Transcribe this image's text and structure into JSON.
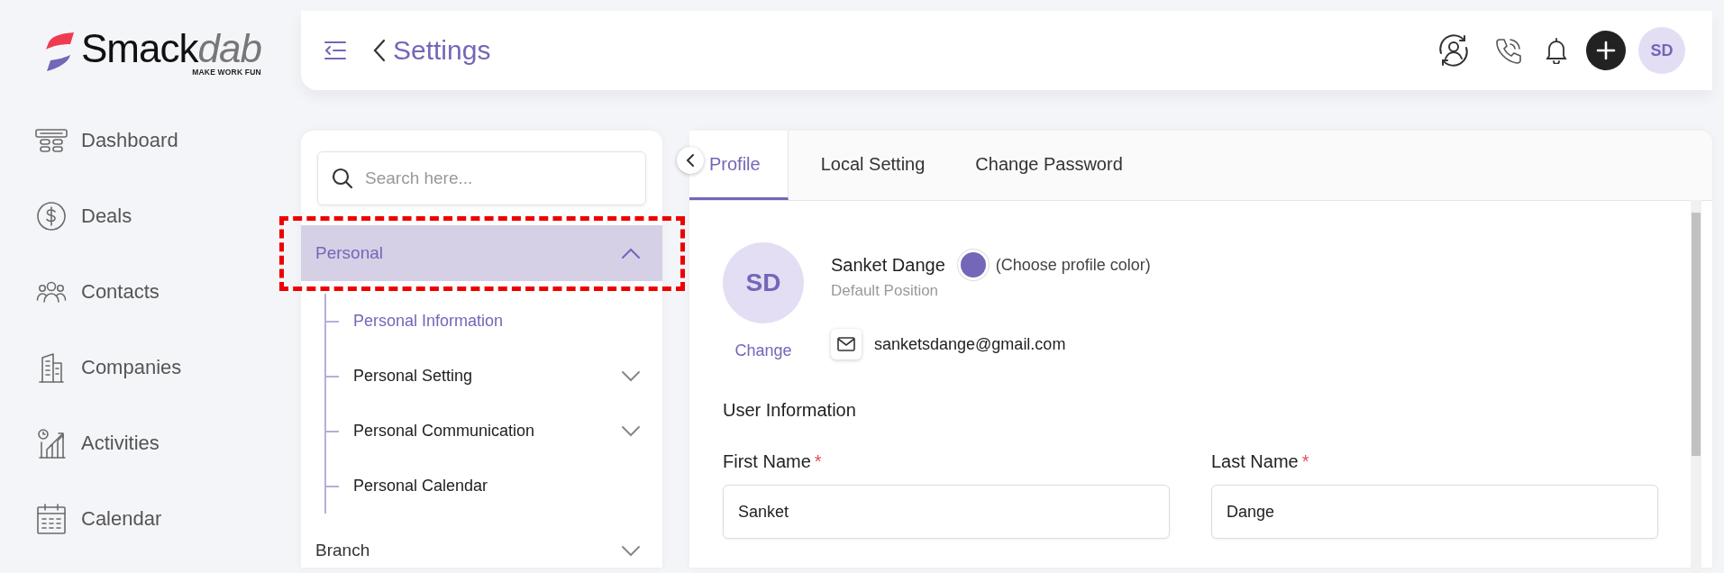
{
  "logo": {
    "name_main": "Smack",
    "name_accent": "dab",
    "tagline": "MAKE WORK FUN"
  },
  "nav": [
    {
      "label": "Dashboard",
      "kind": "dashboard"
    },
    {
      "label": "Deals",
      "kind": "deals"
    },
    {
      "label": "Contacts",
      "kind": "contacts"
    },
    {
      "label": "Companies",
      "kind": "companies"
    },
    {
      "label": "Activities",
      "kind": "activities"
    },
    {
      "label": "Calendar",
      "kind": "calendar"
    }
  ],
  "header": {
    "title": "Settings",
    "avatar": "SD"
  },
  "settings_tree": {
    "search_placeholder": "Search here...",
    "groups": [
      {
        "label": "Personal",
        "expanded": true,
        "selected": true,
        "highlighted": true,
        "children": [
          {
            "label": "Personal Information",
            "kind": "leaf",
            "selected": true
          },
          {
            "label": "Personal Setting",
            "kind": "group",
            "selected": false
          },
          {
            "label": "Personal Communication",
            "kind": "group",
            "selected": false
          },
          {
            "label": "Personal Calendar",
            "kind": "leaf",
            "selected": false
          }
        ]
      },
      {
        "label": "Branch",
        "expanded": false,
        "selected": false,
        "highlighted": false
      }
    ]
  },
  "tabs": [
    {
      "label": "Profile",
      "selected": true
    },
    {
      "label": "Local Setting",
      "selected": false
    },
    {
      "label": "Change Password",
      "selected": false
    }
  ],
  "profile": {
    "initials": "SD",
    "change_link": "Change",
    "name": "Sanket Dange",
    "color": "#7466b8",
    "color_hint": "(Choose profile color)",
    "position": "Default Position",
    "email": "sanketsdange@gmail.com"
  },
  "user_information": {
    "title": "User Information",
    "fields": [
      {
        "label": "First Name",
        "required": true,
        "required_mark": "*",
        "value": "Sanket"
      },
      {
        "label": "Last Name",
        "required": true,
        "required_mark": "*",
        "value": "Dange"
      }
    ]
  }
}
